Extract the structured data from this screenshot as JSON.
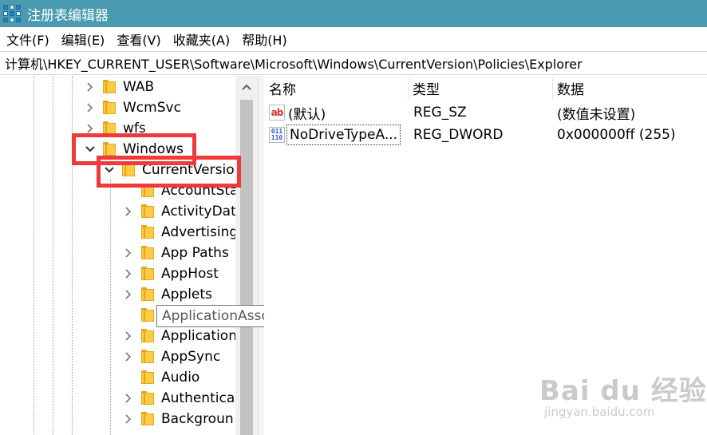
{
  "window": {
    "title": "注册表编辑器"
  },
  "menu": [
    {
      "label": "文件(F)"
    },
    {
      "label": "编辑(E)"
    },
    {
      "label": "查看(V)"
    },
    {
      "label": "收藏夹(A)"
    },
    {
      "label": "帮助(H)"
    }
  ],
  "address": {
    "path": "计算机\\HKEY_CURRENT_USER\\Software\\Microsoft\\Windows\\CurrentVersion\\Policies\\Explorer"
  },
  "tree": {
    "items": [
      {
        "label": "WAB",
        "expander": "collapsed"
      },
      {
        "label": "WcmSvc",
        "expander": "collapsed"
      },
      {
        "label": "wfs",
        "expander": "collapsed"
      },
      {
        "label": "Windows",
        "expander": "expanded"
      },
      {
        "label": "CurrentVersio",
        "expander": "expanded"
      },
      {
        "label": "AccountSta",
        "expander": "none"
      },
      {
        "label": "ActivityDat",
        "expander": "collapsed"
      },
      {
        "label": "Advertising",
        "expander": "none"
      },
      {
        "label": "App Paths",
        "expander": "collapsed"
      },
      {
        "label": "AppHost",
        "expander": "collapsed"
      },
      {
        "label": "Applets",
        "expander": "collapsed"
      },
      {
        "label": "ApplicationAssociationToasts",
        "expander": "none"
      },
      {
        "label": "Application",
        "expander": "collapsed"
      },
      {
        "label": "AppSync",
        "expander": "collapsed"
      },
      {
        "label": "Audio",
        "expander": "none"
      },
      {
        "label": "Authentica",
        "expander": "collapsed"
      },
      {
        "label": "Backgroun",
        "expander": "collapsed"
      }
    ]
  },
  "tooltip": {
    "text": "ApplicationAssociationToasts"
  },
  "list": {
    "columns": {
      "name": "名称",
      "type": "类型",
      "data": "数据"
    },
    "rows": [
      {
        "icon": "string-value-icon",
        "icon_text": "ab",
        "name": "(默认)",
        "type": "REG_SZ",
        "data": "(数值未设置)"
      },
      {
        "icon": "binary-value-icon",
        "icon_text": "011 110",
        "name": "NoDriveTypeA...",
        "type": "REG_DWORD",
        "data": "0x000000ff (255)"
      }
    ]
  },
  "watermark": {
    "logo": "Bai du 经验",
    "url": "jingyan.baidu.com"
  },
  "colors": {
    "titlebar": "#4a9bb1",
    "highlight": "#ee3a3a",
    "folder": "#ffcb44"
  }
}
